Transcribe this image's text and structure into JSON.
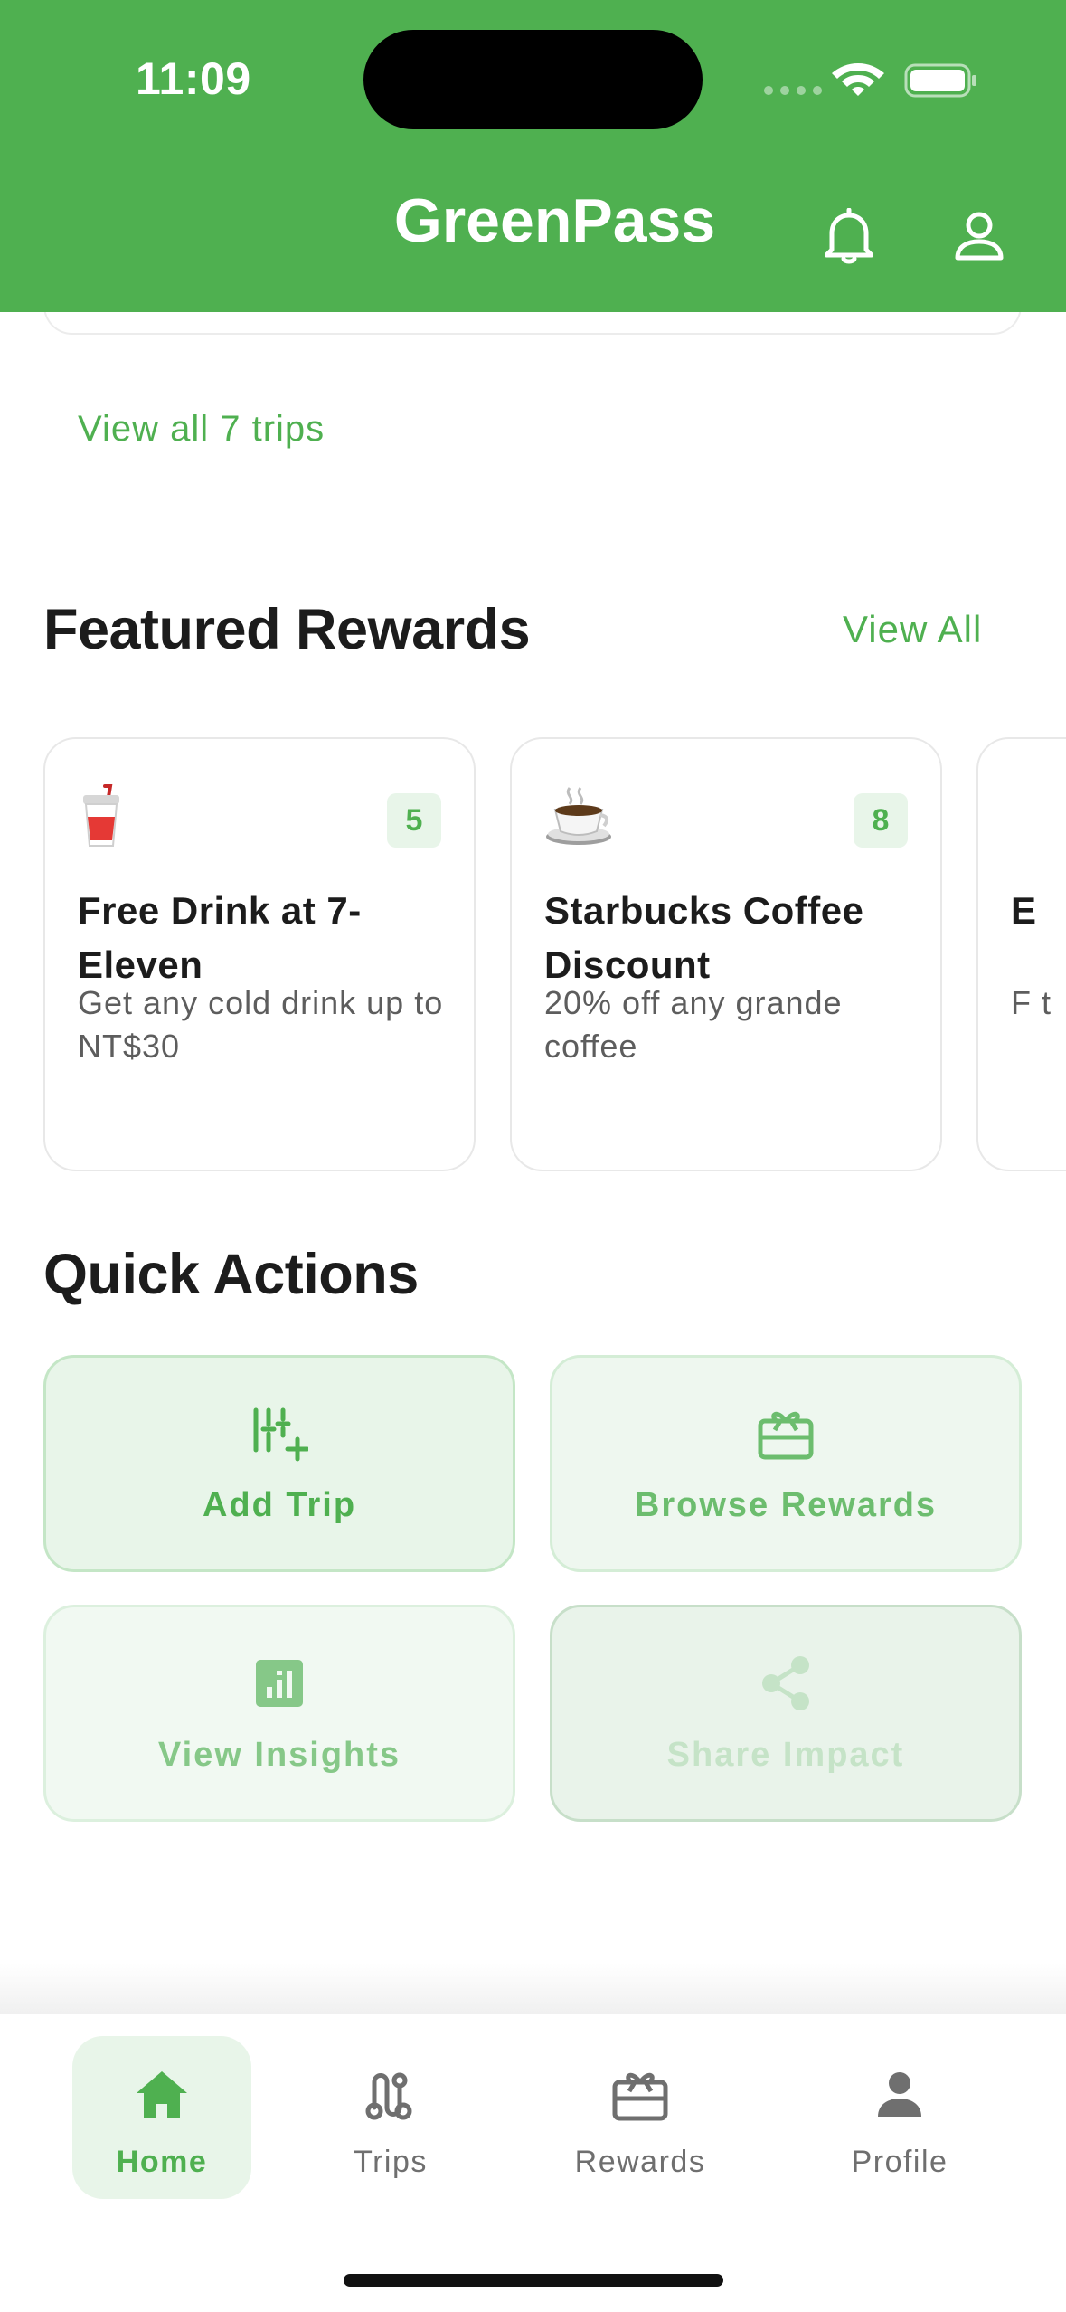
{
  "status_bar": {
    "time": "11:09"
  },
  "header": {
    "title": "GreenPass",
    "accent_color": "#4fb050"
  },
  "trips": {
    "view_all_label": "View all 7 trips"
  },
  "featured_rewards": {
    "title": "Featured Rewards",
    "view_all_label": "View All",
    "items": [
      {
        "emoji": "🥤",
        "points": "5",
        "title": "Free Drink at 7-Eleven",
        "description": "Get any cold drink up to NT$30"
      },
      {
        "emoji": "☕",
        "points": "8",
        "title": "Starbucks Coffee Discount",
        "description": "20% off any grande coffee"
      },
      {
        "title": "E",
        "description": "F t"
      }
    ]
  },
  "quick_actions": {
    "title": "Quick Actions",
    "items": [
      {
        "label": "Add Trip",
        "icon": "add-list-icon"
      },
      {
        "label": "Browse Rewards",
        "icon": "gift-card-icon"
      },
      {
        "label": "View Insights",
        "icon": "insights-chart-icon"
      },
      {
        "label": "Share Impact",
        "icon": "share-icon"
      }
    ]
  },
  "bottom_nav": {
    "items": [
      {
        "label": "Home",
        "icon": "home-icon",
        "active": true
      },
      {
        "label": "Trips",
        "icon": "route-icon"
      },
      {
        "label": "Rewards",
        "icon": "gift-card-icon"
      },
      {
        "label": "Profile",
        "icon": "person-icon"
      }
    ]
  }
}
